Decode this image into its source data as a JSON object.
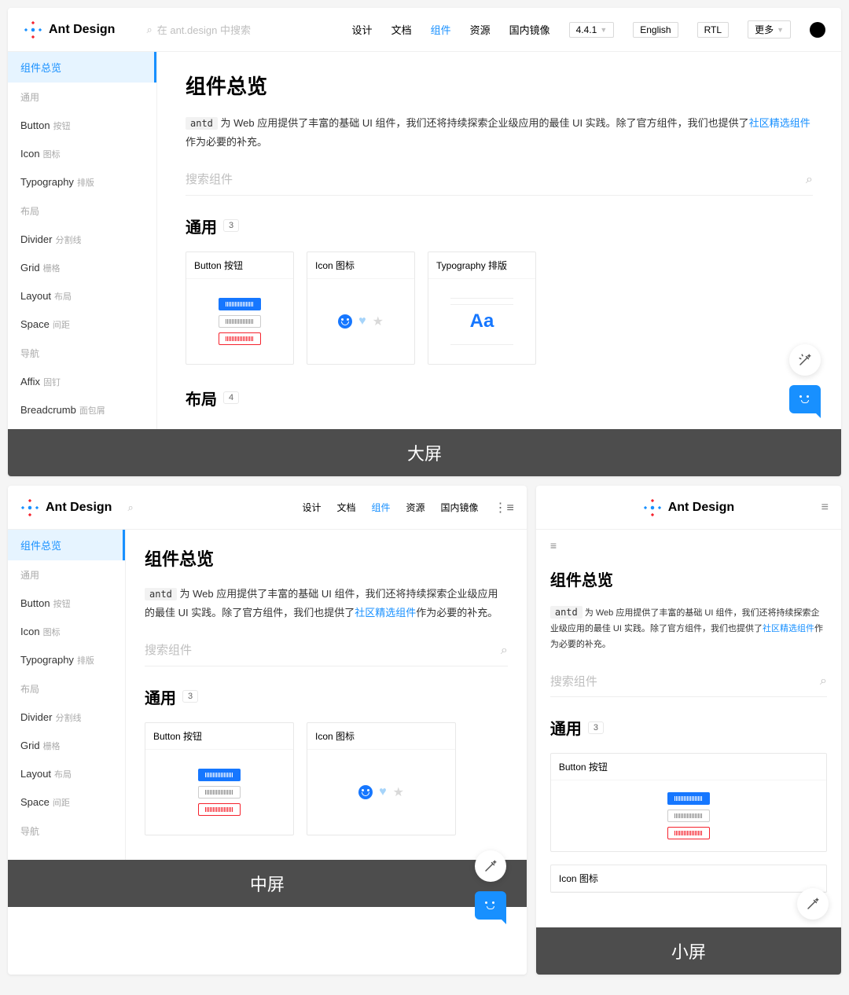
{
  "brand": "Ant Design",
  "search_placeholder": "在 ant.design 中搜索",
  "nav": {
    "design": "设计",
    "docs": "文档",
    "components": "组件",
    "resources": "资源",
    "mirror": "国内镜像"
  },
  "version": "4.4.1",
  "lang": "English",
  "rtl": "RTL",
  "more": "更多",
  "sidebar": {
    "overview": "组件总览",
    "group_general": "通用",
    "button": "Button",
    "button_sub": "按钮",
    "icon": "Icon",
    "icon_sub": "图标",
    "typo": "Typography",
    "typo_sub": "排版",
    "group_layout": "布局",
    "divider": "Divider",
    "divider_sub": "分割线",
    "grid": "Grid",
    "grid_sub": "栅格",
    "layout": "Layout",
    "layout_sub": "布局",
    "space": "Space",
    "space_sub": "间距",
    "group_nav": "导航",
    "affix": "Affix",
    "affix_sub": "固钉",
    "breadcrumb": "Breadcrumb",
    "breadcrumb_sub": "面包屑"
  },
  "page": {
    "title": "组件总览",
    "code": "antd",
    "desc1": " 为 Web 应用提供了丰富的基础 UI 组件，我们还将持续探索企业级应用的最佳 UI 实践。除了官方组件，我们也提供了",
    "link": "社区精选组件",
    "desc2": "作为必要的补充。",
    "search_comp": "搜索组件",
    "sec_general": "通用",
    "count_general": "3",
    "sec_layout": "布局",
    "count_layout": "4",
    "card_button": "Button 按钮",
    "card_icon": "Icon 图标",
    "card_typo": "Typography 排版",
    "typo_sample": "Aa"
  },
  "labels": {
    "large": "大屏",
    "medium": "中屏",
    "small": "小屏"
  }
}
